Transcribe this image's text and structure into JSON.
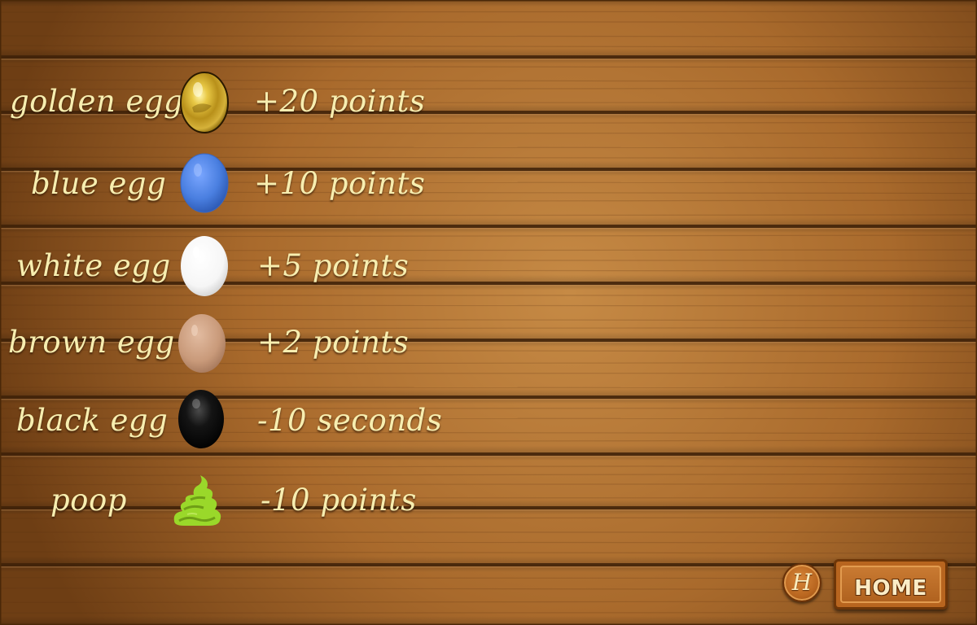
{
  "items": [
    {
      "label": "golden egg",
      "value": "+20 points",
      "icon": "golden-egg-icon"
    },
    {
      "label": "blue egg",
      "value": "+10 points",
      "icon": "blue-egg-icon"
    },
    {
      "label": "white egg",
      "value": "+5 points",
      "icon": "white-egg-icon"
    },
    {
      "label": "brown egg",
      "value": "+2 points",
      "icon": "brown-egg-icon"
    },
    {
      "label": "black egg",
      "value": "-10 seconds",
      "icon": "black-egg-icon"
    },
    {
      "label": "poop",
      "value": "-10 points",
      "icon": "poop-icon"
    }
  ],
  "buttons": {
    "help_label": "H",
    "home_label": "HOME"
  },
  "colors": {
    "text": "#f7eeb0",
    "wood_light": "#b87a3a",
    "wood_dark": "#5e3410",
    "golden_egg": "#d8b22a",
    "blue_egg": "#4a7fe0",
    "white_egg": "#ffffff",
    "brown_egg": "#c99a7a",
    "black_egg": "#0c0c0c",
    "poop": "#9ad82a",
    "button": "#b8651f"
  }
}
